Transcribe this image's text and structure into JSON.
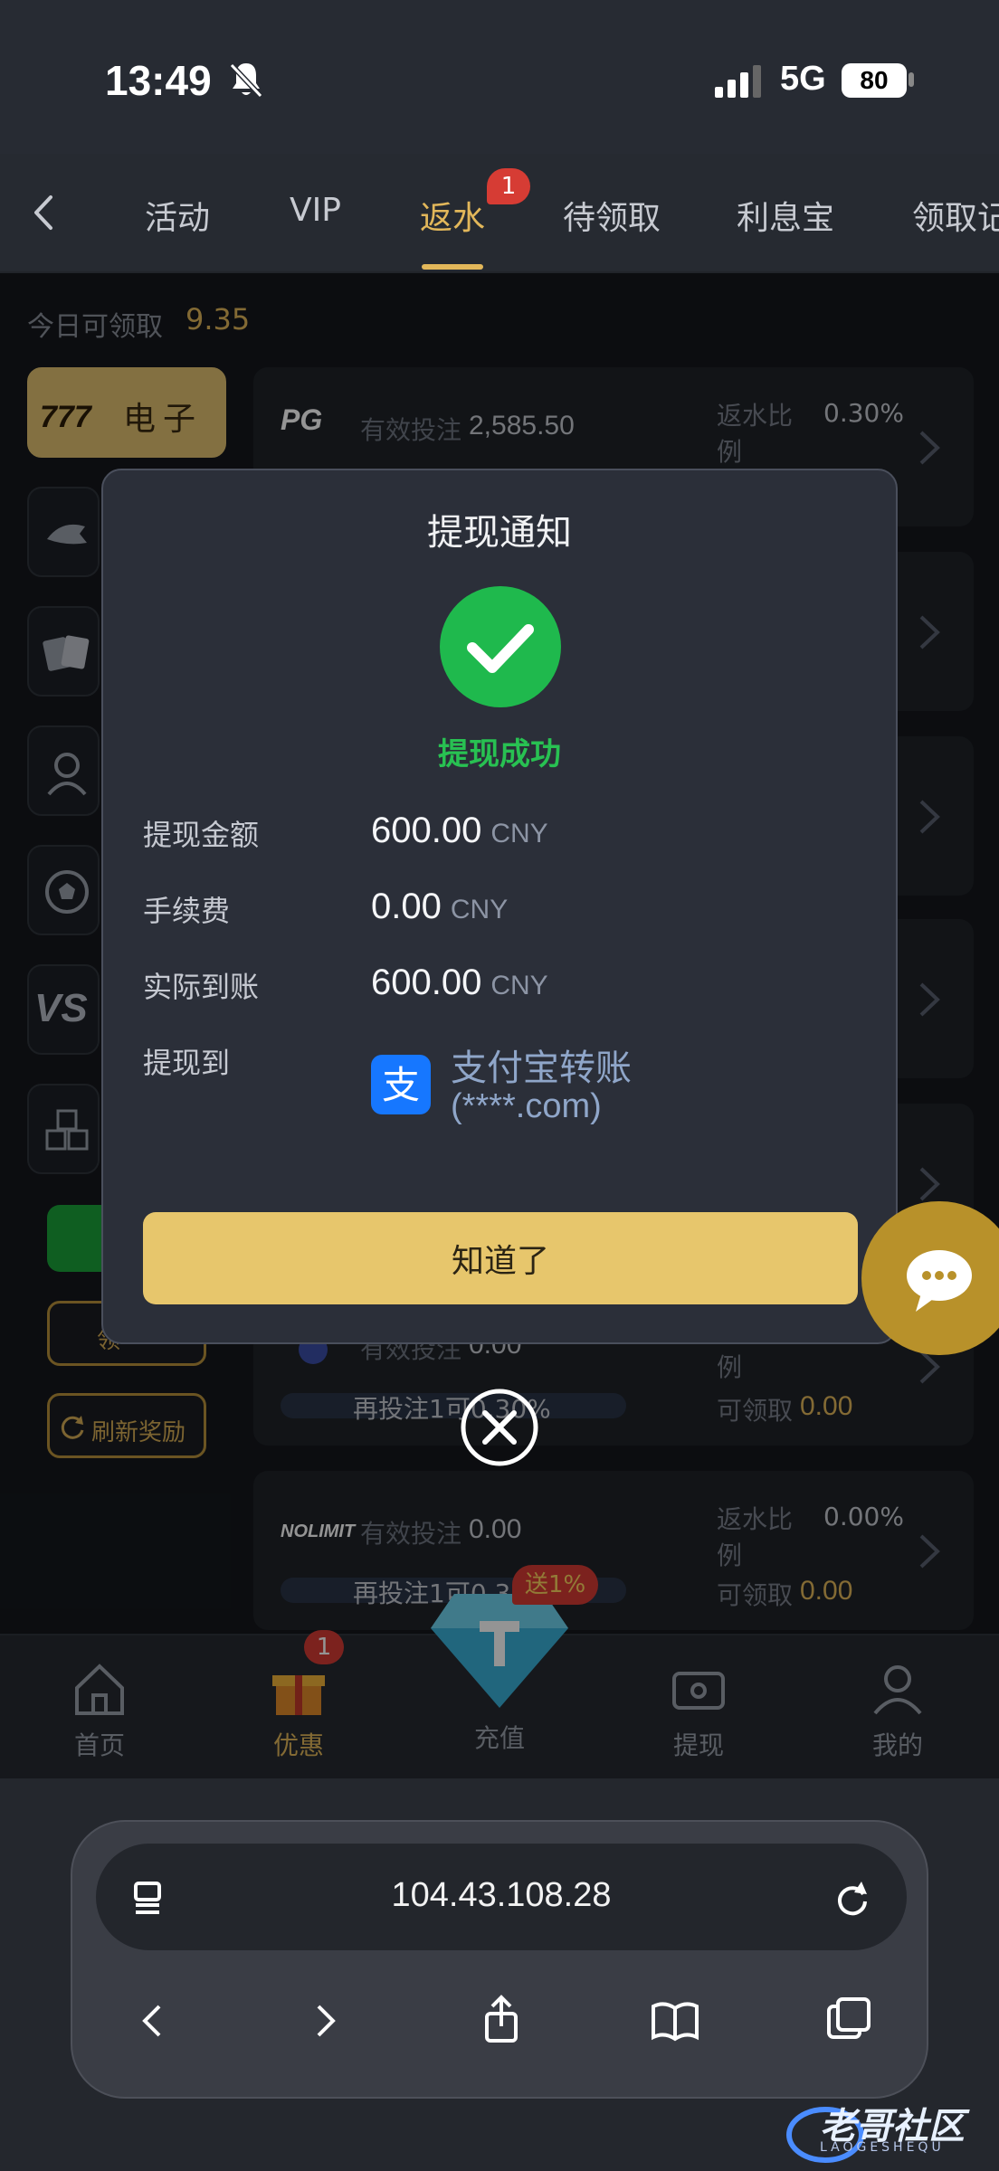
{
  "status_bar": {
    "time": "13:49",
    "network": "5G",
    "battery": "80"
  },
  "tabs": [
    {
      "label": "活动"
    },
    {
      "label": "VIP"
    },
    {
      "label": "返水",
      "badge": "1"
    },
    {
      "label": "待领取"
    },
    {
      "label": "利息宝"
    },
    {
      "label": "领取记"
    }
  ],
  "today": {
    "label": "今日可领取",
    "value": "9.35"
  },
  "category_active": {
    "label": "电子"
  },
  "side_buttons": {
    "claim": "领",
    "refresh": "刷新奖励"
  },
  "rows": [
    {
      "logo": "PG",
      "bet_label": "有效投注",
      "bet": "2,585.50",
      "rate_label": "返水比例",
      "rate": "0.30%"
    },
    {
      "logo": "",
      "bet_label": "有效投注",
      "bet": "0.00",
      "rate_label": "例",
      "claim_label": "可领取",
      "claim": "0.00",
      "progress_text": "再投注1可0.30%"
    },
    {
      "logo": "NOLIMIT",
      "bet_label": "有效投注",
      "bet": "0.00",
      "rate_label": "返水比例",
      "rate": "0.00%",
      "claim_label": "可领取",
      "claim": "0.00",
      "progress_text": "再投注1可0.3"
    }
  ],
  "bottom_nav": {
    "home": "首页",
    "promo": "优惠",
    "promo_badge": "1",
    "deposit": "充值",
    "deposit_tag": "送1%",
    "withdraw": "提现",
    "mine": "我的"
  },
  "browser": {
    "url": "104.43.108.28"
  },
  "modal": {
    "title": "提现通知",
    "status": "提现成功",
    "fields": [
      {
        "label": "提现金额",
        "value": "600.00",
        "currency": "CNY"
      },
      {
        "label": "手续费",
        "value": "0.00",
        "currency": "CNY"
      },
      {
        "label": "实际到账",
        "value": "600.00",
        "currency": "CNY"
      }
    ],
    "dest_label": "提现到",
    "dest_name": "支付宝转账",
    "dest_account": "(****.com)",
    "alipay_glyph": "支",
    "button": "知道了"
  },
  "watermark": {
    "text": "老哥社区",
    "sub": "LAOGESHEQU"
  },
  "colors": {
    "accent_gold": "#e2b75a",
    "success_green": "#1fb94d",
    "alipay_blue": "#1677ff",
    "badge_red": "#d63c34"
  }
}
